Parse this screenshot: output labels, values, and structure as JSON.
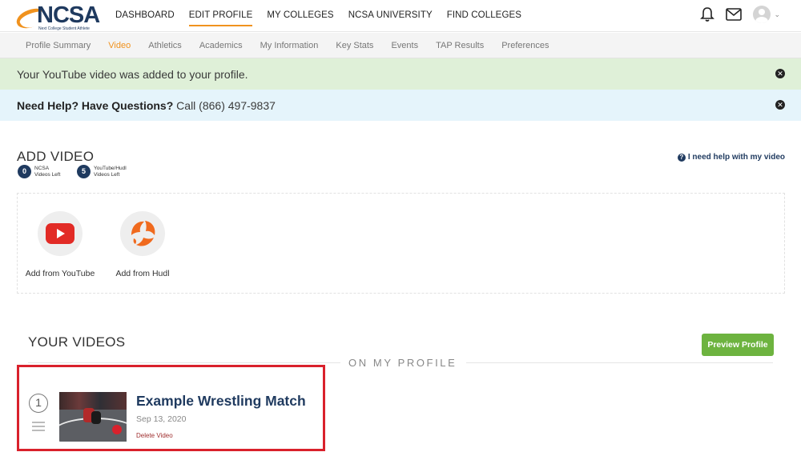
{
  "brand": {
    "name": "NCSA",
    "tagline": "Next College Student Athlete",
    "accent": "#f0921e",
    "navy": "#1f3a5f"
  },
  "mainnav": [
    {
      "label": "DASHBOARD"
    },
    {
      "label": "EDIT PROFILE",
      "active": true
    },
    {
      "label": "MY COLLEGES"
    },
    {
      "label": "NCSA UNIVERSITY"
    },
    {
      "label": "FIND COLLEGES"
    }
  ],
  "topicons": [
    "bell-icon",
    "mail-icon",
    "avatar",
    "chevron-down-icon"
  ],
  "subnav": [
    {
      "label": "Profile Summary"
    },
    {
      "label": "Video",
      "active": true
    },
    {
      "label": "Athletics"
    },
    {
      "label": "Academics"
    },
    {
      "label": "My Information"
    },
    {
      "label": "Key Stats"
    },
    {
      "label": "Events"
    },
    {
      "label": "TAP Results"
    },
    {
      "label": "Preferences"
    }
  ],
  "alerts": {
    "success": {
      "text": "Your YouTube video was added to your profile.",
      "color": "#dff0d8"
    },
    "info": {
      "bold": "Need Help? Have Questions?",
      "text": " Call (866) 497-9837",
      "color": "#e5f4fb"
    }
  },
  "add_video": {
    "title": "ADD VIDEO",
    "ncsa_count": "0",
    "ncsa_label_1": "NCSA",
    "ncsa_label_2": "Videos Left",
    "yt_count": "5",
    "yt_label_1": "YouTube/Hudl",
    "yt_label_2": "Videos Left",
    "help": "I need help with my video",
    "sources": [
      {
        "label": "Add from YouTube",
        "icon": "youtube-icon"
      },
      {
        "label": "Add from Hudl",
        "icon": "hudl-icon"
      }
    ]
  },
  "your_videos": {
    "title": "YOUR VIDEOS",
    "preview_button": "Preview Profile",
    "section_label": "ON MY PROFILE",
    "items": [
      {
        "order": "1",
        "title": "Example Wrestling Match",
        "date": "Sep 13, 2020",
        "delete": "Delete Video"
      }
    ]
  }
}
